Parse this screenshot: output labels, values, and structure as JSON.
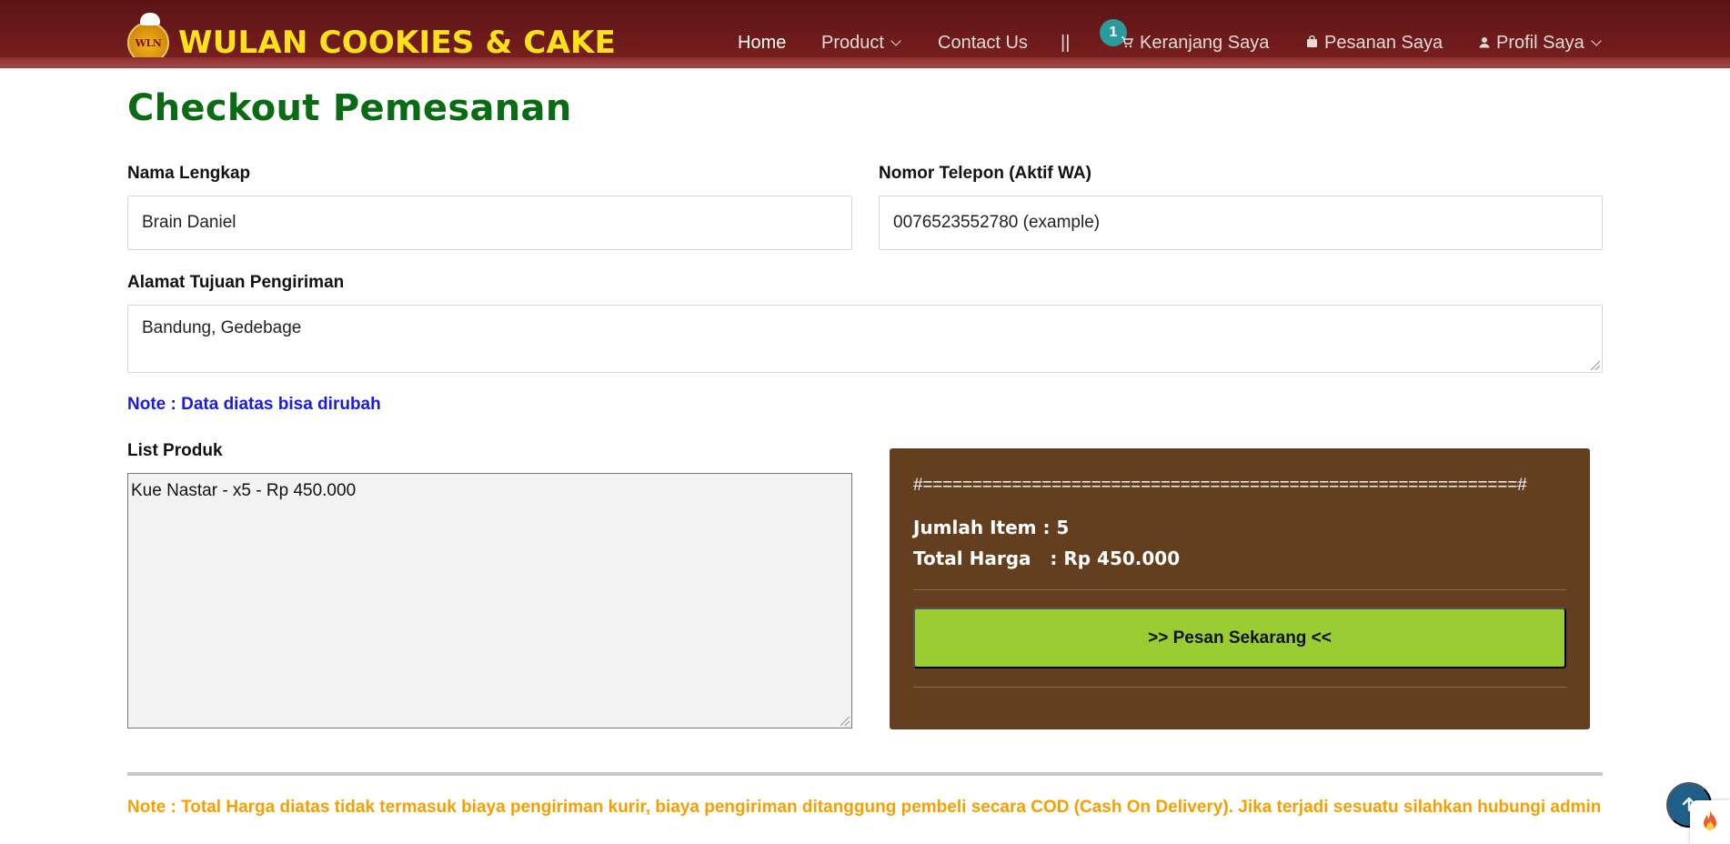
{
  "brand": {
    "name": "WULAN COOKIES & CAKE",
    "logo_text": "WLN"
  },
  "nav": {
    "home": "Home",
    "product": "Product",
    "contact": "Contact Us",
    "separator": "||",
    "cart_count": "1",
    "cart": "Keranjang Saya",
    "orders": "Pesanan Saya",
    "profile": "Profil Saya"
  },
  "page": {
    "title": "Checkout Pemesanan"
  },
  "form": {
    "name_label": "Nama Lengkap",
    "name_value": "Brain Daniel",
    "phone_label": "Nomor Telepon (Aktif WA)",
    "phone_value": "0076523552780 (example)",
    "address_label": "Alamat Tujuan Pengiriman",
    "address_value": "Bandung, Gedebage",
    "note": "Note : Data diatas bisa dirubah"
  },
  "products": {
    "label": "List Produk",
    "content": "Kue Nastar - x5 - Rp 450.000"
  },
  "summary": {
    "rule": "#============================================================#",
    "items_line": "Jumlah Item : 5",
    "total_line": "Total Harga   : Rp 450.000",
    "order_button": ">> Pesan Sekarang <<"
  },
  "footer": {
    "note": "Note : Total Harga diatas tidak termasuk biaya pengiriman kurir, biaya pengiriman ditanggung pembeli secara COD (Cash On Delivery). Jika terjadi sesuatu silahkan hubungi admin"
  },
  "colors": {
    "header_bg": "#6d1a1a",
    "brand_yellow": "#ffe11a",
    "title_green": "#0b6a14",
    "note_blue": "#1b1be0",
    "summary_bg": "#643f1f",
    "order_button_bg": "#9acd32",
    "footer_note": "#f5a000",
    "badge_teal": "#2b9a9a",
    "scroll_top_bg": "#1f5f8b"
  },
  "icons": [
    "cart-icon",
    "bag-icon",
    "user-icon",
    "chevron-down-icon",
    "arrow-up-icon",
    "flame-icon",
    "chef-hat-logo"
  ]
}
